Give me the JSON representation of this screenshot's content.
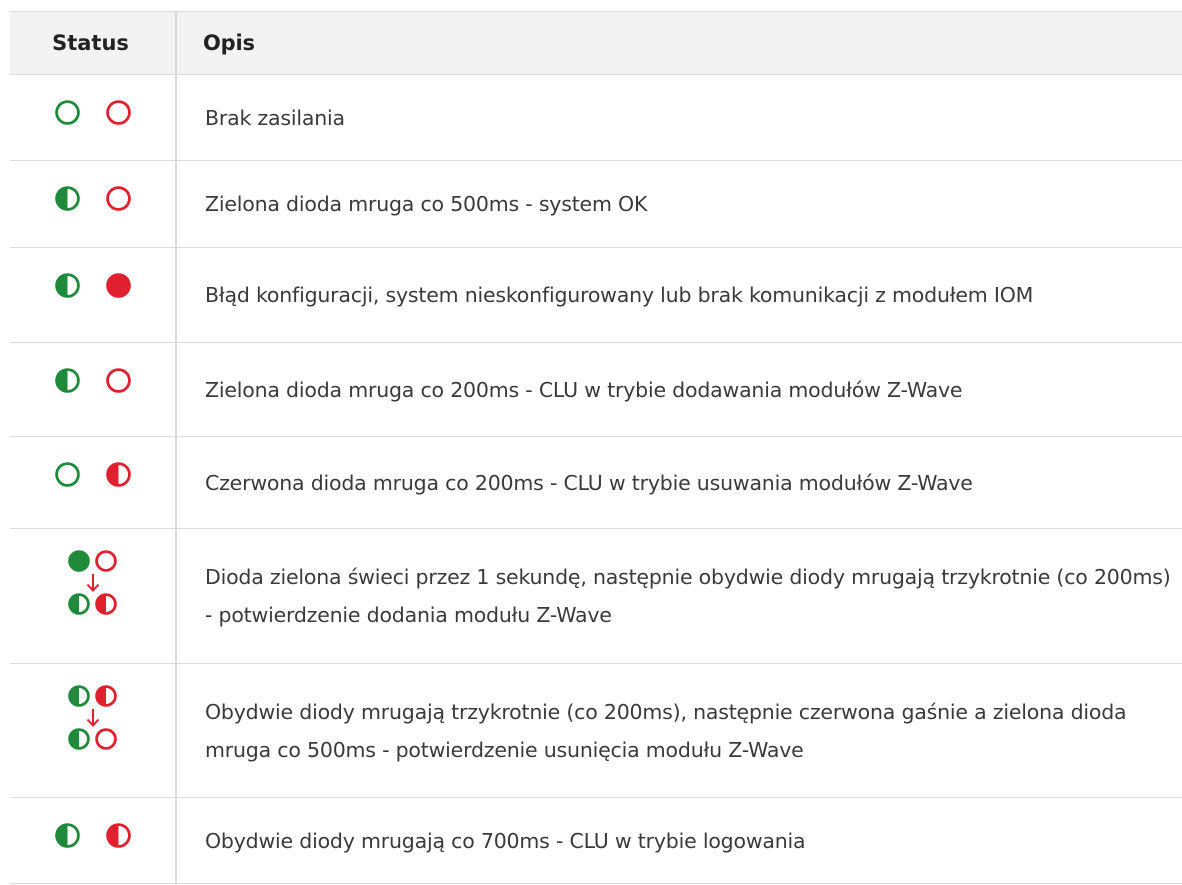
{
  "table": {
    "header": {
      "status": "Status",
      "description": "Opis"
    },
    "rows": [
      {
        "leds": [
          "green-off",
          "red-off"
        ],
        "description": "Brak zasilania"
      },
      {
        "leds": [
          "green-blink",
          "red-off"
        ],
        "description": "Zielona dioda mruga co 500ms - system OK"
      },
      {
        "leds": [
          "green-blink",
          "red-on"
        ],
        "description": "Błąd konfiguracji, system nieskonfigurowany lub brak komunikacji z modułem IOM"
      },
      {
        "leds": [
          "green-blink",
          "red-off"
        ],
        "description": "Zielona dioda mruga co 200ms - CLU w trybie dodawania modułów Z-Wave"
      },
      {
        "leds": [
          "green-off",
          "red-blink"
        ],
        "description": "Czerwona dioda mruga co 200ms - CLU w trybie usuwania modułów Z-Wave"
      },
      {
        "leds_sequence": [
          [
            "green-on",
            "red-off"
          ],
          [
            "green-blink",
            "red-blink"
          ]
        ],
        "description": "Dioda zielona świeci przez 1 sekundę, następnie obydwie diody mrugają trzykrotnie (co 200ms) - potwierdzenie dodania modułu Z-Wave"
      },
      {
        "leds_sequence": [
          [
            "green-blink",
            "red-blink"
          ],
          [
            "green-blink",
            "red-off"
          ]
        ],
        "description": "Obydwie diody mrugają trzykrotnie (co 200ms), następnie czerwona gaśnie a zielona dioda mruga co 500ms - potwierdzenie usunięcia modułu Z-Wave"
      },
      {
        "leds": [
          "green-blink",
          "red-blink"
        ],
        "description": "Obydwie diody mrugają co 700ms - CLU w trybie logowania"
      }
    ]
  },
  "colors": {
    "green": "#1e8a3a",
    "red": "#e0202e",
    "header_bg": "#f2f2f2",
    "border": "#dcdcdc"
  }
}
